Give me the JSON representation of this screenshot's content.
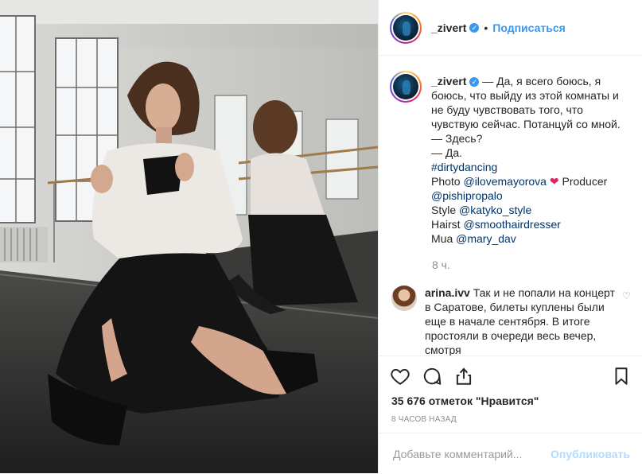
{
  "header": {
    "username": "_zivert",
    "verified_icon": "verified-badge-icon",
    "separator": "•",
    "follow_label": "Подписаться"
  },
  "caption": {
    "username": "_zivert",
    "lines": [
      "— Да, я всего боюсь, я боюсь, что выйду из этой комнаты и не буду чувствовать того, что чувствую сейчас. Потанцуй со мной.",
      "— Здесь?",
      "— Да."
    ],
    "hashtag": "#dirtydancing",
    "photo_prefix": "Photo ",
    "photo_handle": "@ilovemayorova",
    "producer_label": " Producer",
    "producer_handle": "@pishipropalo",
    "style_prefix": "Style ",
    "style_handle": "@katyko_style",
    "hair_prefix": "Hairst ",
    "hair_handle": "@smoothairdresser",
    "mua_prefix": "Mua ",
    "mua_handle": "@mary_dav",
    "heart_icon": "red-heart-icon",
    "time": "8 ч."
  },
  "comment": {
    "username": "arina.ivv",
    "text": "Так и не попали на концерт в Саратове, билеты куплены были еще в начале сентября. В итоге простояли в очереди весь вечер, смотря"
  },
  "actions": {
    "like_icon": "heart-outline-icon",
    "comment_icon": "comment-icon",
    "share_icon": "share-icon",
    "save_icon": "bookmark-icon",
    "likes_text": "35 676 отметок \"Нравится\"",
    "ago_text": "8 ЧАСОВ НАЗАД"
  },
  "add_comment": {
    "placeholder": "Добавьте комментарий...",
    "publish_label": "Опубликовать"
  },
  "colors": {
    "link": "#003569",
    "accent": "#3897f0",
    "muted": "#8e8e8e",
    "publish_disabled": "#b3dbff"
  }
}
